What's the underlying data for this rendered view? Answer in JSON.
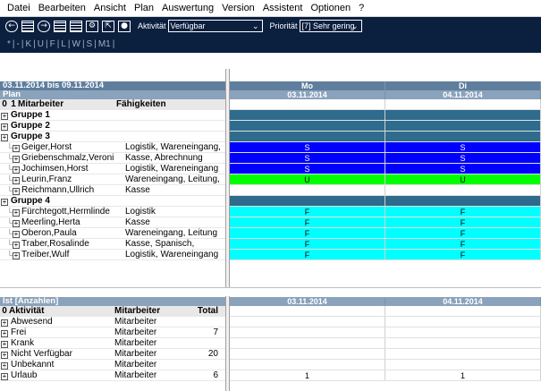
{
  "menu": [
    "Datei",
    "Bearbeiten",
    "Ansicht",
    "Plan",
    "Auswertung",
    "Version",
    "Assistent",
    "Optionen",
    "?"
  ],
  "toolbar": {
    "icons": [
      "back-icon",
      "calendar-icon",
      "forward-icon",
      "grid-icon",
      "list-icon",
      "settings-icon",
      "export-icon",
      "tag-icon"
    ],
    "activity_label": "Aktivität",
    "activity_value": "Verfügbar",
    "priority_label": "Priorität",
    "priority_value": "[7] Sehr gering",
    "chevron": "⌄",
    "filter_buttons": [
      "*",
      "-",
      "K",
      "U",
      "F",
      "L",
      "W",
      "S",
      "M1"
    ]
  },
  "plan": {
    "range": "03.11.2014 bis 09.11.2014",
    "label": "Plan",
    "col_index": "0",
    "col_index2": "1",
    "col_employee": "Mitarbeiter",
    "col_skills": "Fähigkeiten",
    "days": [
      {
        "name": "Mo",
        "date": "03.11.2014"
      },
      {
        "name": "Di",
        "date": "04.11.2014"
      }
    ],
    "rows": [
      {
        "type": "group",
        "name": "Gruppe 1",
        "color": "#2e6b8c",
        "cells": [
          "",
          ""
        ]
      },
      {
        "type": "group",
        "name": "Gruppe 2",
        "color": "#2e6b8c",
        "cells": [
          "",
          ""
        ]
      },
      {
        "type": "group",
        "name": "Gruppe 3",
        "color": "#2e6b8c",
        "cells": [
          "",
          ""
        ]
      },
      {
        "type": "person",
        "name": "Geiger,Horst",
        "skills": "Logistik, Wareneingang,",
        "color": "#0000ff",
        "textcolor": "#ffffff",
        "cells": [
          "S",
          "S"
        ]
      },
      {
        "type": "person",
        "name": "Griebenschmalz,Veroni",
        "skills": "Kasse, Abrechnung",
        "color": "#0000ff",
        "textcolor": "#ffffff",
        "cells": [
          "S",
          "S"
        ]
      },
      {
        "type": "person",
        "name": "Jochimsen,Horst",
        "skills": "Logistik, Wareneingang",
        "color": "#0000ff",
        "textcolor": "#ffffff",
        "cells": [
          "S",
          "S"
        ]
      },
      {
        "type": "person",
        "name": "Leurin,Franz",
        "skills": "Wareneingang, Leitung,",
        "color": "#00ff00",
        "textcolor": "#000000",
        "cells": [
          "U",
          "U"
        ]
      },
      {
        "type": "person",
        "name": "Reichmann,Ullrich",
        "skills": "Kasse",
        "color": "#ffffff",
        "textcolor": "#000000",
        "cells": [
          "",
          ""
        ]
      },
      {
        "type": "group",
        "name": "Gruppe 4",
        "color": "#2e6b8c",
        "cells": [
          "",
          ""
        ]
      },
      {
        "type": "person",
        "name": "Fürchtegott,Hermlinde",
        "skills": "Logistik",
        "color": "#00ffff",
        "textcolor": "#000000",
        "cells": [
          "F",
          "F"
        ]
      },
      {
        "type": "person",
        "name": "Meerling,Herta",
        "skills": "Kasse",
        "color": "#00ffff",
        "textcolor": "#000000",
        "cells": [
          "F",
          "F"
        ]
      },
      {
        "type": "person",
        "name": "Oberon,Paula",
        "skills": "Wareneingang, Leitung",
        "color": "#00ffff",
        "textcolor": "#000000",
        "cells": [
          "F",
          "F"
        ]
      },
      {
        "type": "person",
        "name": "Traber,Rosalinde",
        "skills": "Kasse, Spanisch,",
        "color": "#00ffff",
        "textcolor": "#000000",
        "cells": [
          "F",
          "F"
        ]
      },
      {
        "type": "person",
        "name": "Treiber,Wulf",
        "skills": "Logistik, Wareneingang",
        "color": "#00ffff",
        "textcolor": "#000000",
        "cells": [
          "F",
          "F"
        ]
      }
    ]
  },
  "ist": {
    "label": "Ist [Anzahlen]",
    "col_index": "0",
    "col_activity": "Aktivität",
    "col_employee": "Mitarbeiter",
    "col_total": "Total",
    "dates": [
      "03.11.2014",
      "04.11.2014"
    ],
    "rows": [
      {
        "activity": "Abwesend",
        "employee": "Mitarbeiter",
        "total": "",
        "cells": [
          "",
          ""
        ]
      },
      {
        "activity": "Frei",
        "employee": "Mitarbeiter",
        "total": "7",
        "cells": [
          "",
          ""
        ]
      },
      {
        "activity": "Krank",
        "employee": "Mitarbeiter",
        "total": "",
        "cells": [
          "",
          ""
        ]
      },
      {
        "activity": "Nicht Verfügbar",
        "employee": "Mitarbeiter",
        "total": "20",
        "cells": [
          "",
          ""
        ]
      },
      {
        "activity": "Unbekannt",
        "employee": "Mitarbeiter",
        "total": "",
        "cells": [
          "",
          ""
        ]
      },
      {
        "activity": "Urlaub",
        "employee": "Mitarbeiter",
        "total": "6",
        "cells": [
          "1",
          "1"
        ]
      }
    ]
  }
}
